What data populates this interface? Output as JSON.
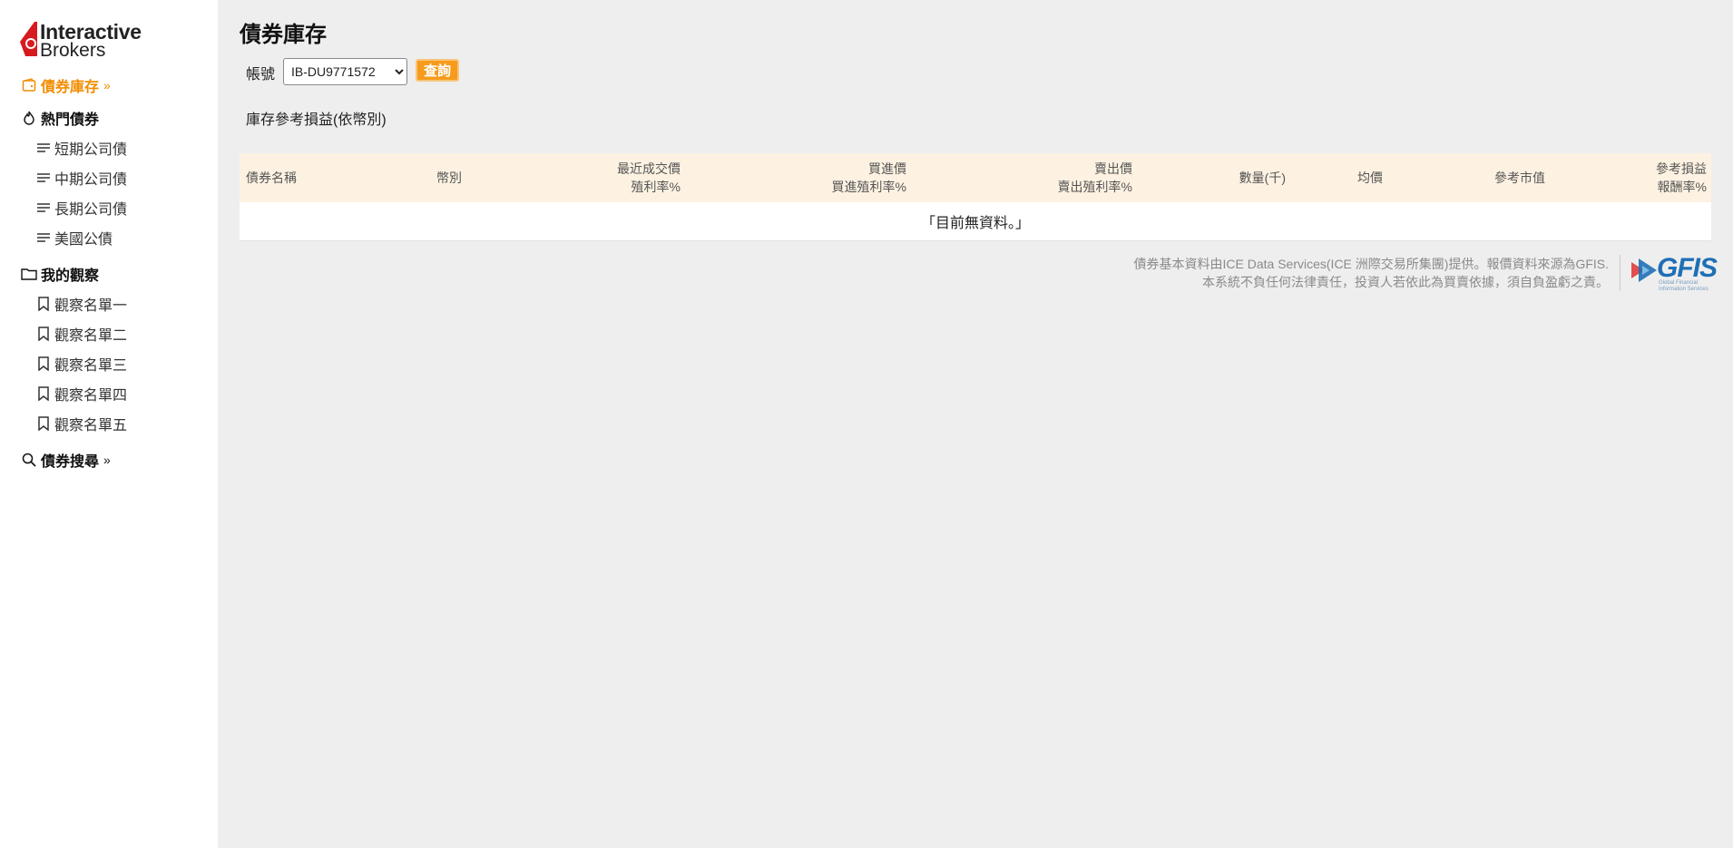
{
  "logo": {
    "line1": "Interactive",
    "line2": "Brokers"
  },
  "nav": {
    "holdings": "債券庫存",
    "hot": "熱門債券",
    "hot_items": [
      "短期公司債",
      "中期公司債",
      "長期公司債",
      "美國公債"
    ],
    "watch": "我的觀察",
    "watch_items": [
      "觀察名單一",
      "觀察名單二",
      "觀察名單三",
      "觀察名單四",
      "觀察名單五"
    ],
    "search": "債券搜尋"
  },
  "page": {
    "title": "債券庫存",
    "account_label": "帳號",
    "account_value": "IB-DU9771572",
    "query_button": "查詢",
    "subhead": "庫存參考損益(依幣別)"
  },
  "table": {
    "headers": {
      "name": "債券名稱",
      "currency": "幣別",
      "last_price": "最近成交價",
      "last_yield": "殖利率%",
      "bid": "買進價",
      "bid_yield": "買進殖利率%",
      "ask": "賣出價",
      "ask_yield": "賣出殖利率%",
      "qty": "數量(千)",
      "avg": "均價",
      "market_value": "參考市值",
      "pnl": "參考損益",
      "return": "報酬率%"
    },
    "empty_message": "「目前無資料。」"
  },
  "footer": {
    "line1": "債券基本資料由ICE Data Services(ICE 洲際交易所集團)提供。報價資料來源為GFIS.",
    "line2": "本系統不負任何法律責任，投資人若依此為買賣依據，須自負盈虧之責。",
    "gfis_logo": "GFIS",
    "gfis_sub1": "Global Financial",
    "gfis_sub2": "Information Services"
  },
  "colors": {
    "accent": "#f28c00",
    "button": "#f79b1c",
    "header_bg": "#fdf2e2",
    "logo_red": "#d71920",
    "gfis_blue": "#1f6fb5"
  }
}
